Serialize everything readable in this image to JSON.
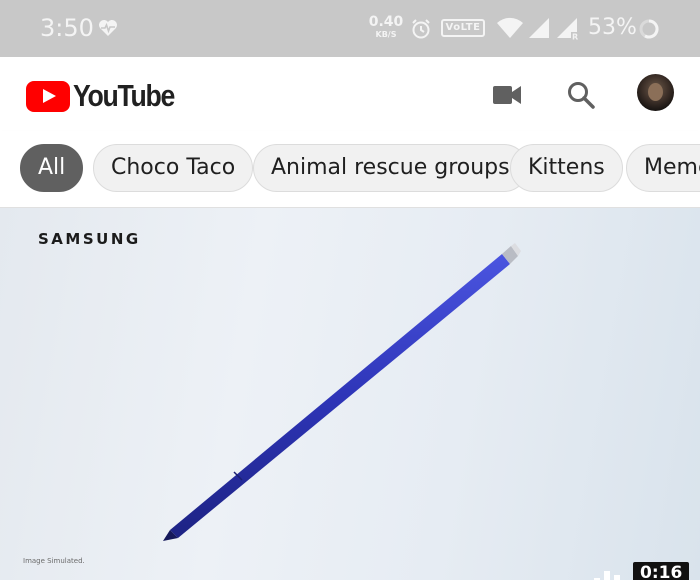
{
  "status_bar": {
    "time": "3:50",
    "net_speed_value": "0.40",
    "net_speed_unit": "KB/S",
    "volte_label": "VoLTE",
    "battery_percent": "53%",
    "icons": [
      "heart-pulse-icon",
      "alarm-icon",
      "wifi-icon",
      "signal-icon",
      "signal-roaming-icon",
      "battery-ring-icon"
    ]
  },
  "header": {
    "logo_text": "YouTube",
    "icons": [
      "camera-icon",
      "search-icon"
    ],
    "brand_color": "#ff0000"
  },
  "chips": [
    {
      "label": "All",
      "active": true
    },
    {
      "label": "Choco Taco",
      "active": false
    },
    {
      "label": "Animal rescue groups",
      "active": false
    },
    {
      "label": "Kittens",
      "active": false
    },
    {
      "label": "Memes",
      "active": false
    }
  ],
  "video": {
    "brand_text": "SAMSUNG",
    "disclaimer": "Image Simulated.",
    "duration": "0:16",
    "pen_color": "#2e35b8"
  }
}
